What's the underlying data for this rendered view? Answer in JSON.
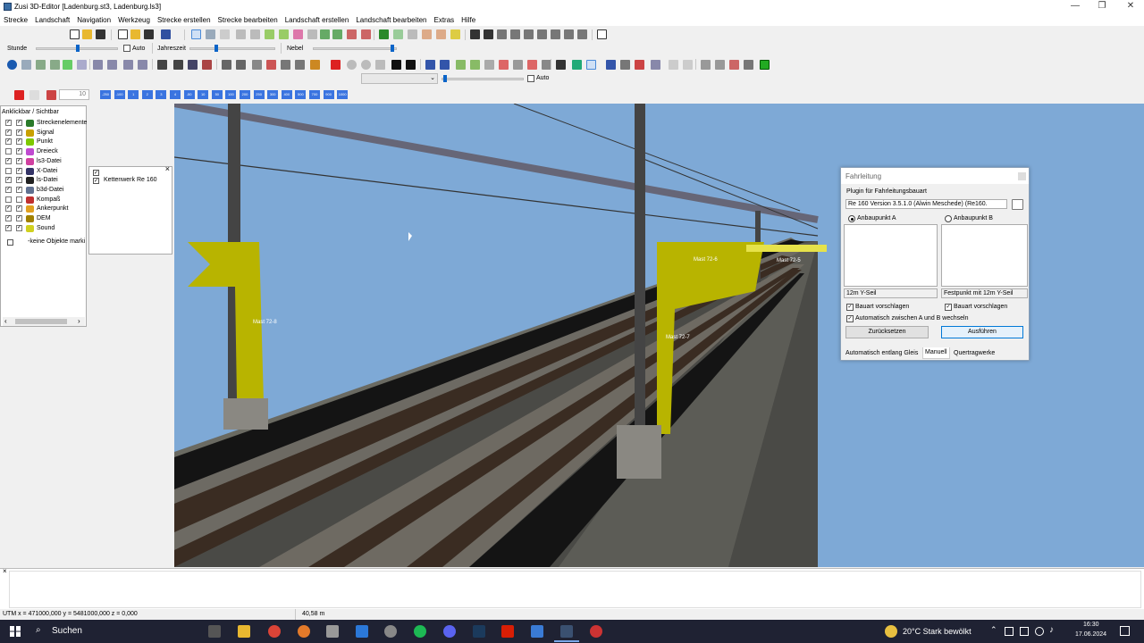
{
  "window": {
    "title": "Zusi 3D-Editor [Ladenburg.st3, Ladenburg.ls3]",
    "minimize": "—",
    "maximize": "❐",
    "close": "✕"
  },
  "menu": [
    "Strecke",
    "Landschaft",
    "Navigation",
    "Werkzeug",
    "Strecke erstellen",
    "Strecke bearbeiten",
    "Landschaft erstellen",
    "Landschaft bearbeiten",
    "Extras",
    "Hilfe"
  ],
  "toolbar2": {
    "stunde": "Stunde",
    "auto": "Auto",
    "jahreszeit": "Jahreszeit",
    "nebel": "Nebel"
  },
  "toolbar3": {
    "auto": "Auto"
  },
  "toolbar4": {
    "field_value": "10",
    "zoom_labels": [
      "-250",
      "-100",
      "1",
      "2",
      "3",
      "4",
      "-50",
      "10",
      "50",
      "100",
      "200",
      "250",
      "300",
      "400",
      "500",
      "700",
      "900",
      "1000"
    ]
  },
  "leftpanel": {
    "header": "Anklickbar / Sichtbar",
    "layers": [
      {
        "label": "Streckenelemente",
        "a": true,
        "b": true,
        "color": "#2a7a2a"
      },
      {
        "label": "Signal",
        "a": true,
        "b": true,
        "color": "#c8a000"
      },
      {
        "label": "Punkt",
        "a": true,
        "b": true,
        "color": "#7ec800"
      },
      {
        "label": "Dreieck",
        "a": false,
        "b": true,
        "color": "#c04ad0"
      },
      {
        "label": "ls3-Datei",
        "a": true,
        "b": true,
        "color": "#d040a0"
      },
      {
        "label": "X-Datei",
        "a": false,
        "b": true,
        "color": "#333366"
      },
      {
        "label": "ls-Datei",
        "a": true,
        "b": true,
        "color": "#222222"
      },
      {
        "label": "b3d-Datei",
        "a": true,
        "b": true,
        "color": "#607090"
      },
      {
        "label": "Kompaß",
        "a": false,
        "b": false,
        "color": "#c03030"
      },
      {
        "label": "Ankerpunkt",
        "a": true,
        "b": true,
        "color": "#e0a020"
      },
      {
        "label": "DEM",
        "a": true,
        "b": true,
        "color": "#a08000"
      },
      {
        "label": "Sound",
        "a": true,
        "b": true,
        "color": "#d0d020"
      }
    ],
    "no_objects": "-keine Objekte marki"
  },
  "subpanel": {
    "close": "×",
    "item": "Kettenwerk Re 160"
  },
  "viewport": {
    "masts": [
      "Mast 72-8",
      "Mast 72-7",
      "Mast 72-6",
      "Mast 72-5"
    ]
  },
  "dialog": {
    "title": "Fahrleitung",
    "plugin_label": "Plugin für Fahrleitungsbauart",
    "plugin_value": "Re 160  Version  3.5.1.0 (Alwin Meschede) (Re160.",
    "radio_a": "Anbaupunkt A",
    "radio_b": "Anbaupunkt B",
    "dd_a": "12m Y-Seil",
    "dd_b": "Festpunkt mit 12m Y-Seil",
    "chk_a": "Bauart vorschlagen",
    "chk_b": "Bauart vorschlagen",
    "chk_auto": "Automatisch zwischen A und B wechseln",
    "btn_reset": "Zurücksetzen",
    "btn_run": "Ausführen",
    "tabs": [
      "Automatisch entlang Gleis",
      "Manuell",
      "Quertragwerke"
    ]
  },
  "bottompane": {
    "close": "×"
  },
  "statusbar": {
    "coords": "UTM x = 471000,000  y = 5481000,000  z = 0,000",
    "distance": "40,58 m"
  },
  "taskbar": {
    "search": "Suchen",
    "weather": "20°C  Stark bewölkt",
    "time": "16:30",
    "date": "17.06.2024"
  }
}
